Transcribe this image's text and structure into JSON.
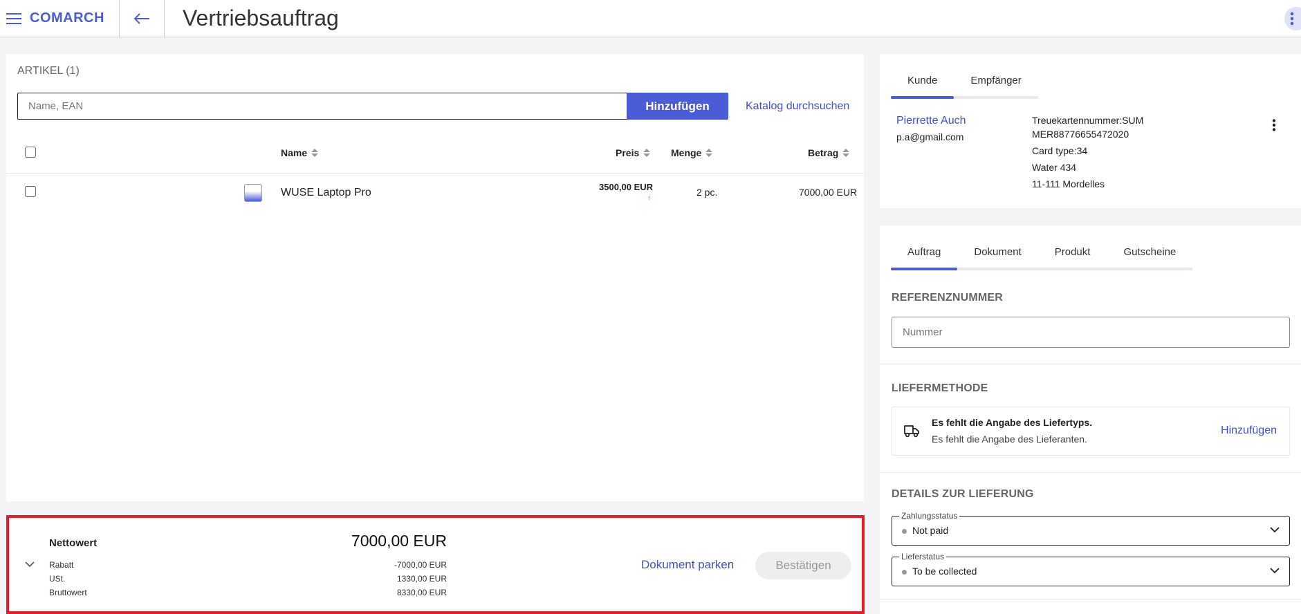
{
  "header": {
    "logo": "COMARCH",
    "title": "Vertriebsauftrag"
  },
  "articles": {
    "title": "ARTIKEL (1)",
    "search_placeholder": "Name, EAN",
    "add_label": "Hinzufügen",
    "catalog_link": "Katalog durchsuchen",
    "columns": {
      "name": "Name",
      "price": "Preis",
      "quantity": "Menge",
      "amount": "Betrag"
    },
    "rows": [
      {
        "name": "WUSE Laptop Pro",
        "price": "3500,00 EUR",
        "quantity": "2 pc.",
        "amount": "7000,00 EUR"
      }
    ]
  },
  "summary": {
    "net_label": "Nettowert",
    "net_value": "7000,00 EUR",
    "discount_label": "Rabatt",
    "discount_value": "-7000,00 EUR",
    "vat_label": "USt.",
    "vat_value": "1330,00 EUR",
    "gross_label": "Bruttowert",
    "gross_value": "8330,00 EUR",
    "park_label": "Dokument parken",
    "confirm_label": "Bestätigen"
  },
  "customer": {
    "tabs": [
      "Kunde",
      "Empfänger"
    ],
    "name": "Pierrette Auch",
    "email": "p.a@gmail.com",
    "loyalty_line1": "Treuekartennummer:SUM",
    "loyalty_line2": "MER88776655472020",
    "card_type": "Card type:34",
    "street": "Water 434",
    "city": "11-111 Mordelles"
  },
  "order": {
    "tabs": [
      "Auftrag",
      "Dokument",
      "Produkt",
      "Gutscheine"
    ],
    "reference_title": "REFERENZNUMMER",
    "reference_placeholder": "Nummer",
    "delivery_title": "LIEFERMETHODE",
    "delivery_missing_type": "Es fehlt die Angabe des Liefertyps.",
    "delivery_missing_supplier": "Es fehlt die Angabe des Lieferanten.",
    "delivery_add": "Hinzufügen",
    "details_title": "DETAILS ZUR LIEFERUNG",
    "payment_status_label": "Zahlungsstatus",
    "payment_status_value": "Not paid",
    "delivery_status_label": "Lieferstatus",
    "delivery_status_value": "To be collected"
  },
  "colors": {
    "accent": "#4a5cd6",
    "link": "#3f51c8",
    "highlight_border": "#e0202b"
  }
}
